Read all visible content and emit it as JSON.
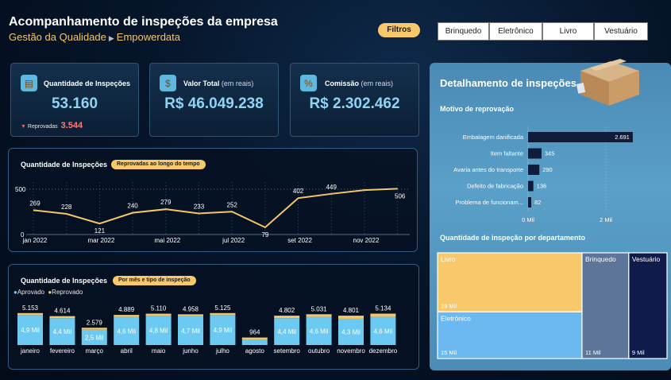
{
  "header": {
    "title": "Acompanhamento de inspeções da empresa",
    "subtitle_a": "Gestão da Qualidade",
    "subtitle_sep": "▶",
    "subtitle_b": "Empowerdata",
    "filters_label": "Filtros",
    "segments": [
      "Brinquedo",
      "Eletrônico",
      "Livro",
      "Vestuário"
    ]
  },
  "kpis": {
    "inspections": {
      "icon": "clipboard-icon",
      "label": "Quantidade de Inspeções",
      "value": "53.160",
      "rejected_label": "Reprovadas",
      "rejected_value": "3.544"
    },
    "total": {
      "icon": "money-icon",
      "label": "Valor Total",
      "unit": "(em reais)",
      "value": "R$ 46.049.238"
    },
    "commission": {
      "icon": "commission-icon",
      "label": "Comissão",
      "unit": "(em reais)",
      "value": "R$ 2.302.462"
    }
  },
  "line_panel": {
    "title": "Quantidade de Inspeções",
    "chip": "Reprovadas ao longo do tempo"
  },
  "bar_panel": {
    "title": "Quantidade de Inspeções",
    "chip": "Por mês e tipo de inspeção",
    "legend": [
      "Aprovado",
      "Reprovado"
    ]
  },
  "detail": {
    "title": "Detalhamento de inspeções",
    "reasons_title": "Motivo de reprovação",
    "treemap_title": "Quantidade de inspeção por departamento"
  },
  "colors": {
    "accent": "#f7c96a",
    "approved": "#6ccaf2",
    "rejected": "#f3c66b",
    "navy": "#101c3a"
  },
  "chart_data": [
    {
      "type": "line",
      "x": [
        "jan 2022",
        "fev 2022",
        "mar 2022",
        "abr 2022",
        "mai 2022",
        "jun 2022",
        "jul 2022",
        "ago 2022",
        "set 2022",
        "out 2022",
        "nov 2022",
        "dez 2022"
      ],
      "x_tick_labels": [
        "jan 2022",
        "mar 2022",
        "mai 2022",
        "jul 2022",
        "set 2022",
        "nov 2022"
      ],
      "y_ticks": [
        "0",
        "500"
      ],
      "ylim": [
        0,
        500
      ],
      "values": [
        269,
        228,
        121,
        240,
        279,
        233,
        252,
        79,
        402,
        449,
        490,
        506
      ],
      "labels": [
        "269",
        "228",
        "121",
        "240",
        "279",
        "233",
        "252",
        "79",
        "402",
        "449",
        "",
        "506"
      ]
    },
    {
      "type": "bar",
      "categories": [
        "janeiro",
        "fevereiro",
        "março",
        "abril",
        "maio",
        "junho",
        "julho",
        "agosto",
        "setembro",
        "outubro",
        "novembro",
        "dezembro"
      ],
      "series": [
        {
          "name": "Aprovado",
          "values": [
            4900,
            4400,
            2500,
            4600,
            4800,
            4700,
            4900,
            900,
            4400,
            4600,
            4300,
            4600
          ],
          "labels": [
            "4,9 Mil",
            "4,4 Mil",
            "2,5 Mil",
            "4,6 Mil",
            "4,8 Mil",
            "4,7 Mil",
            "4,9 Mil",
            "",
            "4,4 Mil",
            "4,6 Mil",
            "4,3 Mil",
            "4,6 Mil"
          ]
        },
        {
          "name": "Reprovado",
          "values": [
            253,
            214,
            79,
            289,
            310,
            258,
            225,
            64,
            402,
            431,
            501,
            534
          ]
        }
      ],
      "totals": [
        "5.153",
        "4.614",
        "2.579",
        "4.889",
        "5.110",
        "4.958",
        "5.125",
        "964",
        "4.802",
        "5.031",
        "4.801",
        "5.134"
      ]
    },
    {
      "type": "bar",
      "orientation": "horizontal",
      "categories": [
        "Embalagem danificada",
        "Item faltante",
        "Avaria antes do transporte",
        "Defeito de fabricação",
        "Problema de funcionam..."
      ],
      "values": [
        2691,
        345,
        290,
        136,
        82
      ],
      "value_labels": [
        "2.691",
        "345",
        "290",
        "136",
        "82"
      ],
      "x_ticks": [
        "0 Mil",
        "2 Mil"
      ]
    },
    {
      "type": "treemap",
      "items": [
        {
          "name": "Livro",
          "value": 19000,
          "label": "19 Mil"
        },
        {
          "name": "Eletrônico",
          "value": 15000,
          "label": "15 Mil"
        },
        {
          "name": "Brinquedo",
          "value": 11000,
          "label": "11 Mil"
        },
        {
          "name": "Vestuário",
          "value": 9000,
          "label": "9 Mil"
        }
      ]
    }
  ]
}
